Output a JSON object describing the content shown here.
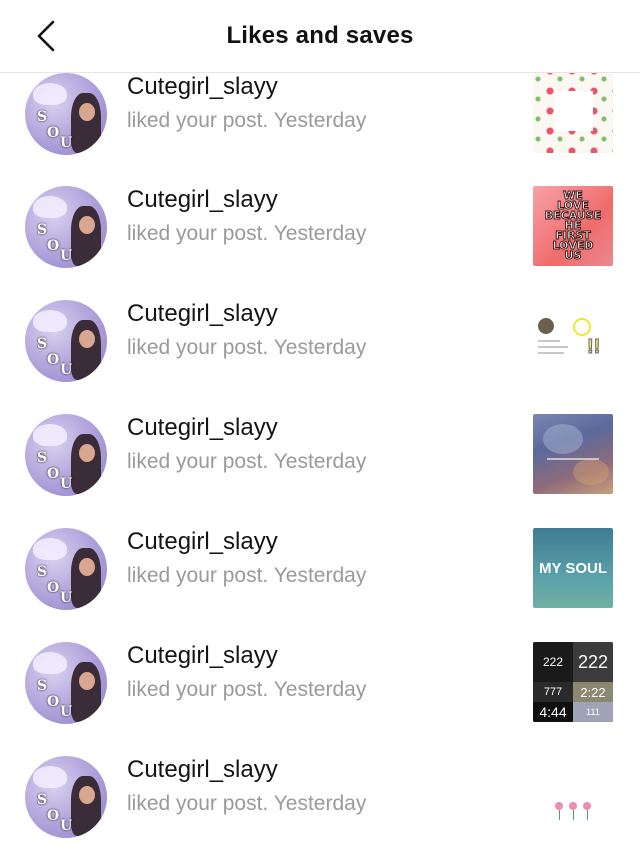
{
  "header": {
    "title": "Likes and saves",
    "back_icon": "chevron-left-icon"
  },
  "notifications": [
    {
      "username": "Cutegirl_slayy",
      "action": "liked your post.",
      "time": "Yesterday"
    },
    {
      "username": "Cutegirl_slayy",
      "action": "liked your post.",
      "time": "Yesterday"
    },
    {
      "username": "Cutegirl_slayy",
      "action": "liked your post.",
      "time": "Yesterday"
    },
    {
      "username": "Cutegirl_slayy",
      "action": "liked your post.",
      "time": "Yesterday"
    },
    {
      "username": "Cutegirl_slayy",
      "action": "liked your post.",
      "time": "Yesterday"
    },
    {
      "username": "Cutegirl_slayy",
      "action": "liked your post.",
      "time": "Yesterday"
    },
    {
      "username": "Cutegirl_slayy",
      "action": "liked your post.",
      "time": "Yesterday"
    }
  ],
  "thumbnails": {
    "t2_text": [
      "WE",
      "LOVE",
      "BECAUSE",
      "HE",
      "FIRST",
      "LOVED",
      "US"
    ],
    "t5_text": "MY SOUL",
    "t6_numbers": [
      "222",
      "222",
      "777",
      "2:22",
      "4:44",
      "111"
    ]
  },
  "colors": {
    "accent": "#111111",
    "subtext": "#9a9a9a",
    "divider": "#e6e6e6"
  }
}
